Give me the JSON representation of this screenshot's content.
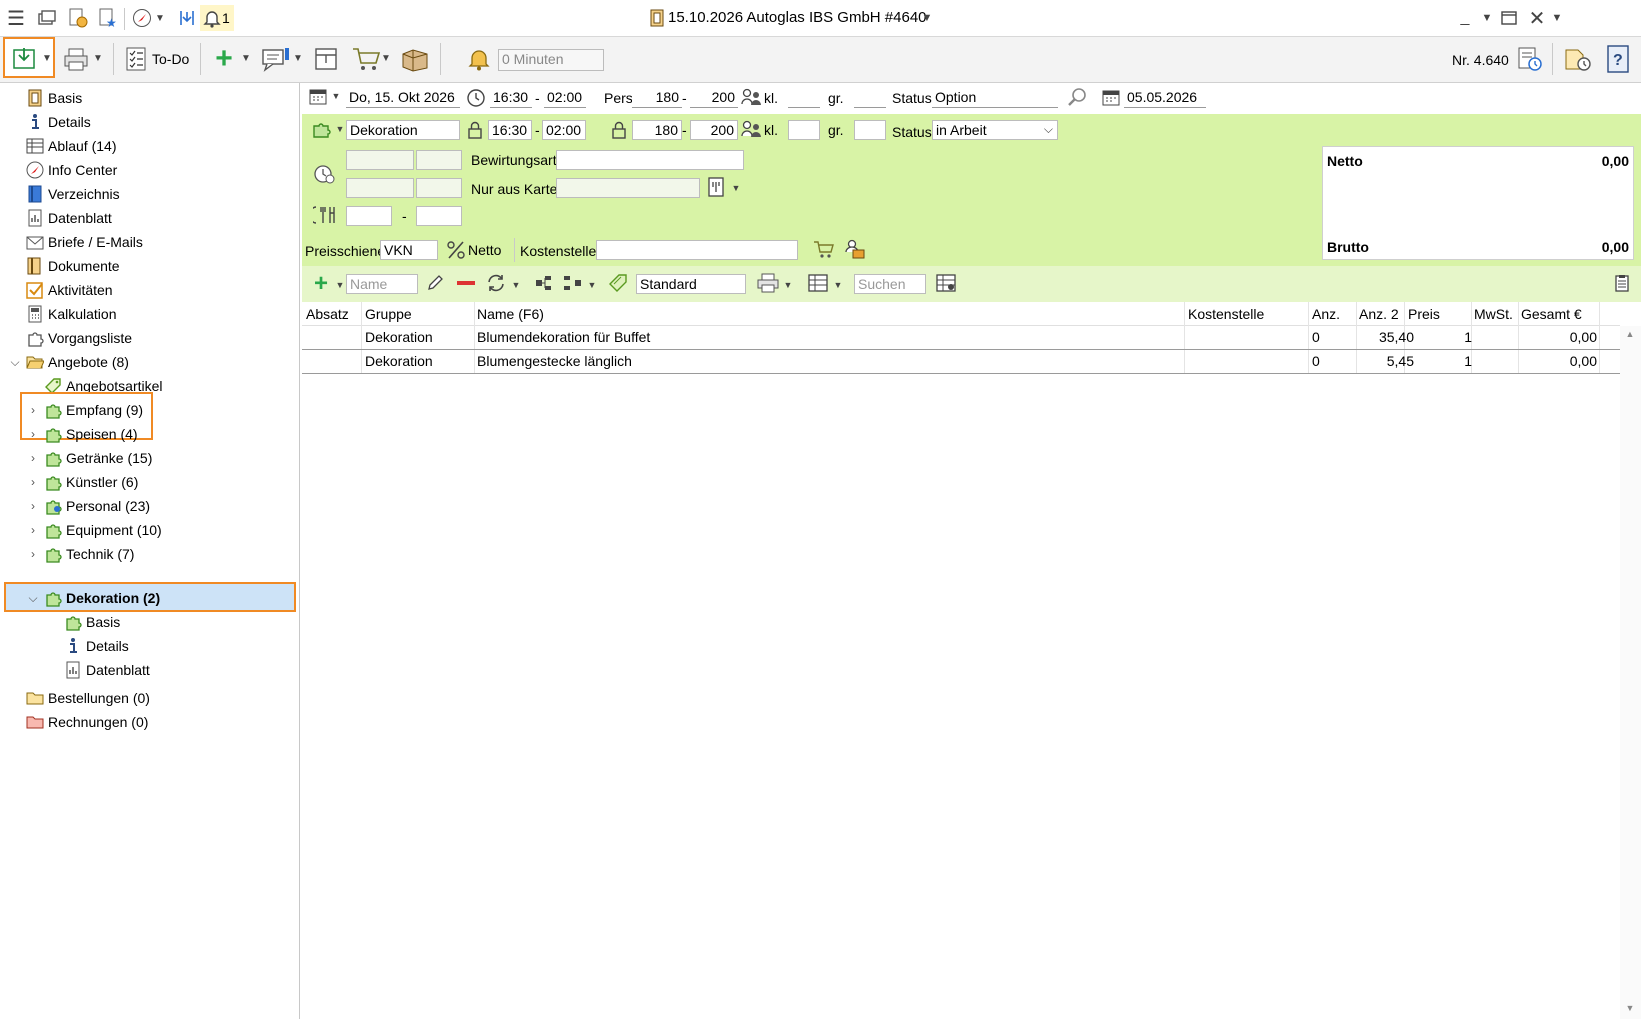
{
  "titlebar": {
    "title": "15.10.2026 Autoglas IBS GmbH  #4640",
    "notification_count": "1"
  },
  "toolbar": {
    "todo_label": "To-Do",
    "reminder_value": "0 Minuten",
    "number": "Nr. 4.640"
  },
  "sidebar": {
    "items": [
      {
        "label": "Basis"
      },
      {
        "label": "Details"
      },
      {
        "label": "Ablauf (14)"
      },
      {
        "label": "Info Center"
      },
      {
        "label": "Verzeichnis"
      },
      {
        "label": "Datenblatt"
      },
      {
        "label": "Briefe / E-Mails"
      },
      {
        "label": "Dokumente"
      },
      {
        "label": "Aktivitäten"
      },
      {
        "label": "Kalkulation"
      },
      {
        "label": "Vorgangsliste"
      },
      {
        "label": "Angebote (8)"
      },
      {
        "label": "Angebotsartikel"
      },
      {
        "label": "Empfang (9)"
      },
      {
        "label": "Speisen (4)"
      },
      {
        "label": "Getränke (15)"
      },
      {
        "label": "Künstler (6)"
      },
      {
        "label": "Personal (23)"
      },
      {
        "label": "Equipment (10)"
      },
      {
        "label": "Technik (7)"
      },
      {
        "label": "Dekoration (2)"
      },
      {
        "label": "Basis"
      },
      {
        "label": "Details"
      },
      {
        "label": "Datenblatt"
      },
      {
        "label": "Bestellungen (0)"
      },
      {
        "label": "Rechnungen (0)"
      }
    ]
  },
  "event": {
    "date": "Do, 15. Okt 2026",
    "time_from": "16:30",
    "time_to": "02:00",
    "pers_label": "Pers.",
    "pers_from": "180",
    "pers_to": "200",
    "kl_label": "kl.",
    "gr_label": "gr.",
    "status_label": "Status",
    "status_value": "Option",
    "option_date": "05.05.2026"
  },
  "section": {
    "name": "Dekoration",
    "time_from": "16:30",
    "time_to": "02:00",
    "pers_from": "180",
    "pers_to": "200",
    "kl_label": "kl.",
    "gr_label": "gr.",
    "status_label": "Status",
    "status_value": "in Arbeit",
    "bewirtungsart_label": "Bewirtungsart",
    "nur_aus_karte_label": "Nur aus Karte",
    "dash": "-",
    "preisschiene_label": "Preisschiene",
    "preisschiene_value": "VKN",
    "netto_toggle": "Netto",
    "kostenstelle_label": "Kostenstelle"
  },
  "totals": {
    "netto_label": "Netto",
    "netto_value": "0,00",
    "brutto_label": "Brutto",
    "brutto_value": "0,00"
  },
  "itembar": {
    "name_placeholder": "Name",
    "view_value": "Standard",
    "search_placeholder": "Suchen"
  },
  "grid": {
    "headers": [
      "Absatz",
      "Gruppe",
      "Name (F6)",
      "Kostenstelle",
      "Anz.",
      "Anz. 2",
      "Preis",
      "MwSt.",
      "Gesamt €"
    ],
    "rows": [
      {
        "absatz": "",
        "gruppe": "Dekoration",
        "name": "Blumendekoration für Buffet",
        "kostenstelle": "",
        "anz": "0",
        "anz2": "",
        "preis": "35,40",
        "mwst": "1",
        "gesamt": "0,00"
      },
      {
        "absatz": "",
        "gruppe": "Dekoration",
        "name": "Blumengestecke länglich",
        "kostenstelle": "",
        "anz": "0",
        "anz2": "",
        "preis": "5,45",
        "mwst": "1",
        "gesamt": "0,00"
      }
    ]
  }
}
